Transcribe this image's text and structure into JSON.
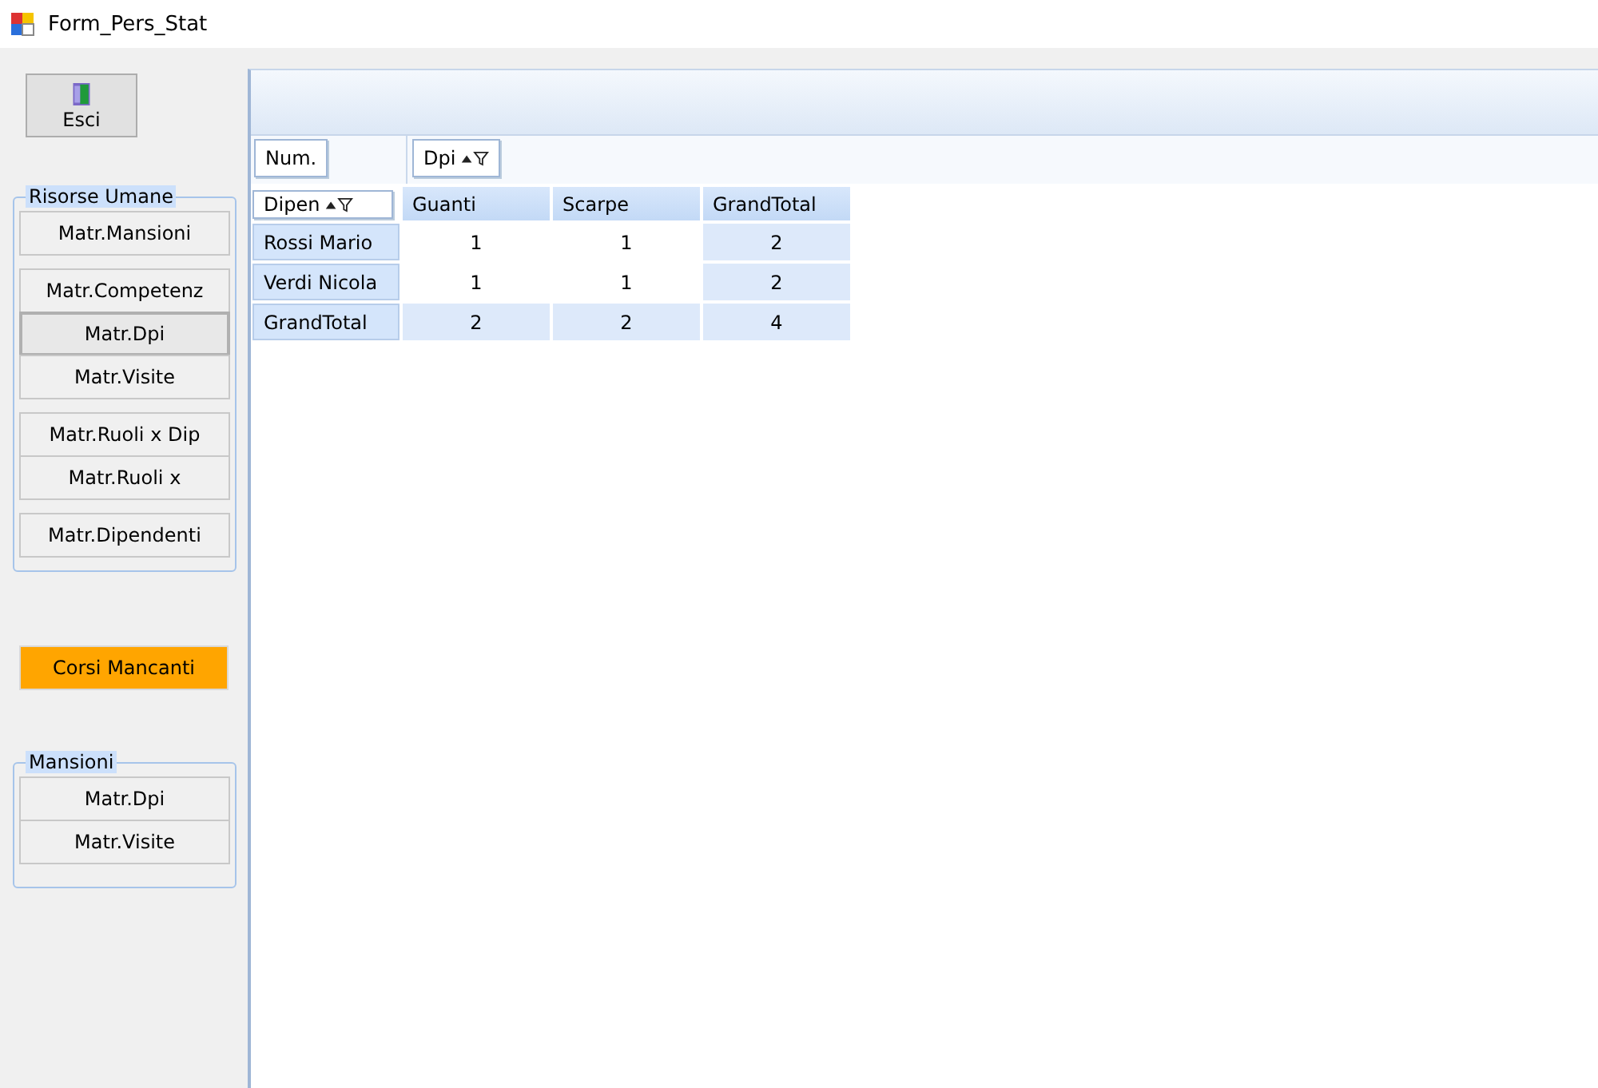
{
  "window": {
    "title": "Form_Pers_Stat"
  },
  "exit_button": {
    "label": "Esci"
  },
  "groups": [
    {
      "title": "Risorse Umane",
      "clusters": [
        [
          {
            "label": "Matr.Mansioni",
            "focused": false
          }
        ],
        [
          {
            "label": "Matr.Competenz",
            "focused": false
          },
          {
            "label": "Matr.Dpi",
            "focused": true
          },
          {
            "label": "Matr.Visite",
            "focused": false
          }
        ],
        [
          {
            "label": "Matr.Ruoli x Dip",
            "focused": false
          },
          {
            "label": "Matr.Ruoli x",
            "focused": false
          }
        ],
        [
          {
            "label": "Matr.Dipendenti",
            "focused": false
          }
        ]
      ]
    }
  ],
  "highlight_button": {
    "label": "Corsi Mancanti"
  },
  "groups_bottom": [
    {
      "title": "Mansioni",
      "clusters": [
        [
          {
            "label": "Matr.Dpi",
            "focused": false
          },
          {
            "label": "Matr.Visite",
            "focused": false
          }
        ]
      ]
    }
  ],
  "pivot": {
    "data_field": "Num.",
    "column_field": "Dpi",
    "row_field": "Dipen",
    "columns": [
      "Guanti",
      "Scarpe",
      "GrandTotal"
    ],
    "rows": [
      {
        "label": "Rossi Mario",
        "values": [
          "1",
          "1",
          "2"
        ],
        "kind": "data"
      },
      {
        "label": "Verdi Nicola",
        "values": [
          "1",
          "1",
          "2"
        ],
        "kind": "data"
      },
      {
        "label": "GrandTotal",
        "values": [
          "2",
          "2",
          "4"
        ],
        "kind": "total"
      }
    ]
  }
}
